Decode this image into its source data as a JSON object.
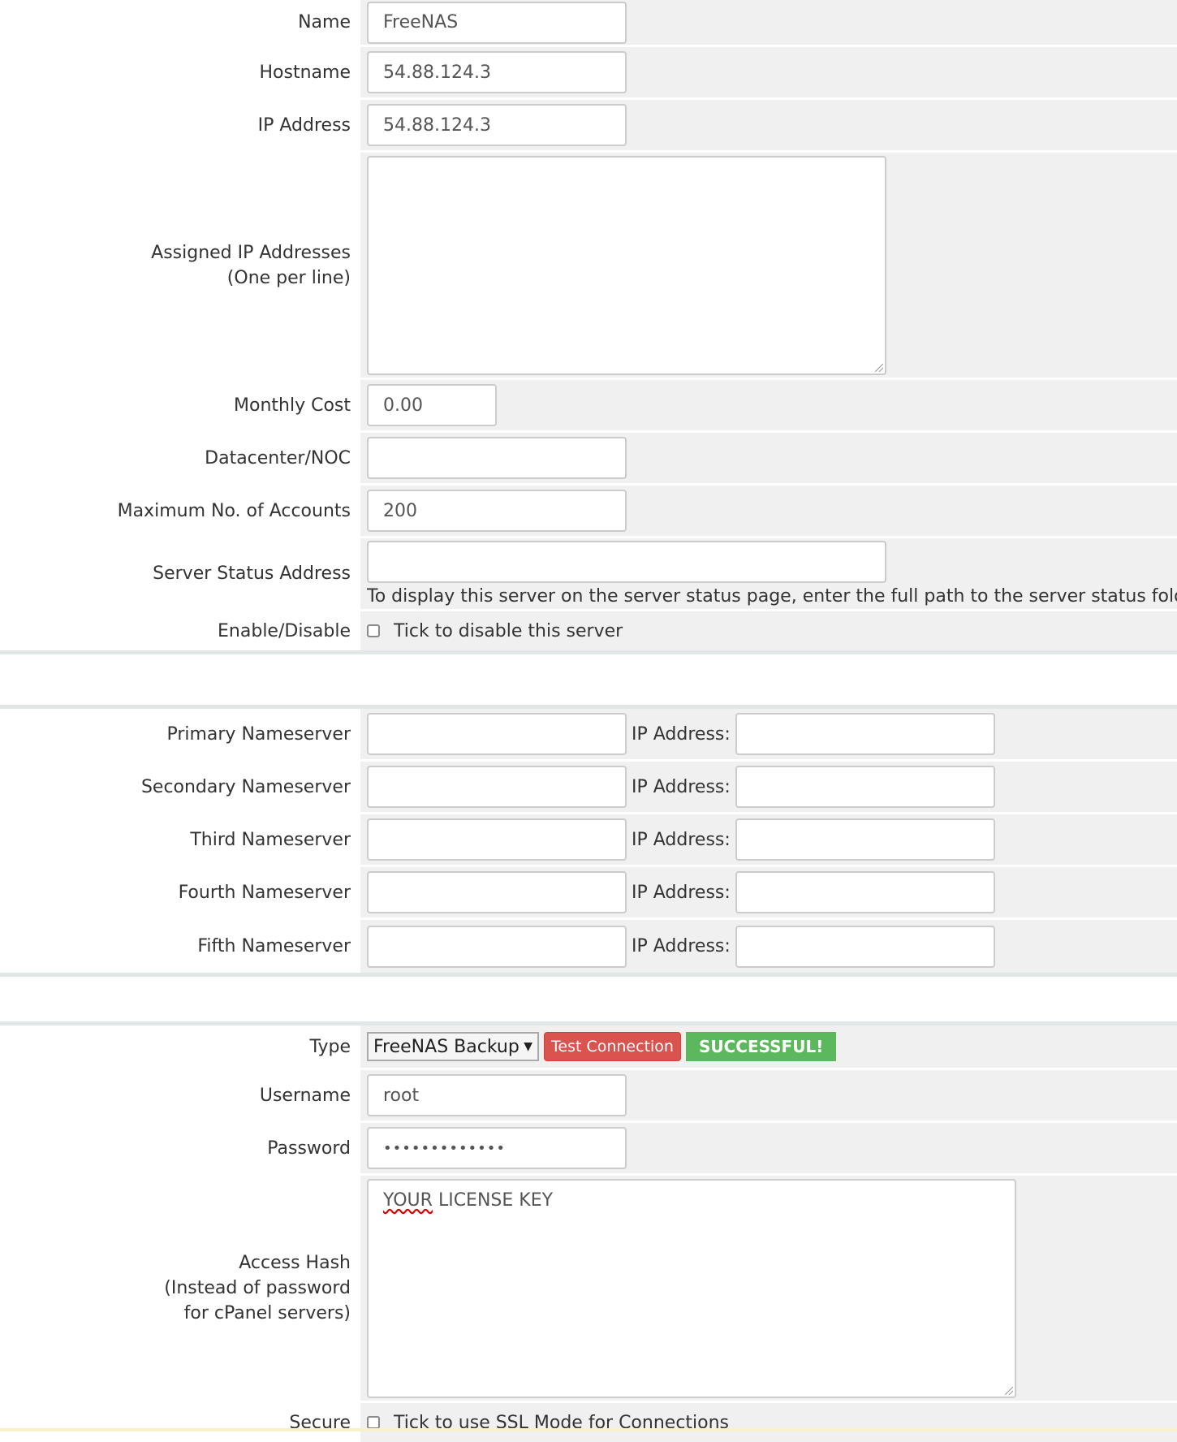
{
  "server": {
    "name_label": "Name",
    "name_value": "FreeNAS",
    "hostname_label": "Hostname",
    "hostname_value": "54.88.124.3",
    "ip_label": "IP Address",
    "ip_value": "54.88.124.3",
    "assigned_label_1": "Assigned IP Addresses",
    "assigned_label_2": "(One per line)",
    "assigned_value": "",
    "cost_label": "Monthly Cost",
    "cost_value": "0.00",
    "datacenter_label": "Datacenter/NOC",
    "datacenter_value": "",
    "max_label": "Maximum No. of Accounts",
    "max_value": "200",
    "status_label": "Server Status Address",
    "status_value": "",
    "status_help": "To display this server on the server status page, enter the full path to the server status folder (re",
    "disable_label": "Enable/Disable",
    "disable_text": "Tick to disable this server"
  },
  "nameservers": {
    "ip_label": "IP Address:",
    "items": [
      {
        "label": "Primary Nameserver",
        "value": "",
        "ip": ""
      },
      {
        "label": "Secondary Nameserver",
        "value": "",
        "ip": ""
      },
      {
        "label": "Third Nameserver",
        "value": "",
        "ip": ""
      },
      {
        "label": "Fourth Nameserver",
        "value": "",
        "ip": ""
      },
      {
        "label": "Fifth Nameserver",
        "value": "",
        "ip": ""
      }
    ]
  },
  "module": {
    "type_label": "Type",
    "type_value": "FreeNAS Backup",
    "test_button": "Test Connection",
    "status_badge": "SUCCESSFUL!",
    "username_label": "Username",
    "username_value": "root",
    "password_label": "Password",
    "password_value": "•••••••••••••",
    "hash_label_1": "Access Hash",
    "hash_label_2": "(Instead of password",
    "hash_label_3": "for cPanel servers)",
    "hash_value_1": "YOUR",
    "hash_value_2": " LICENSE KEY",
    "secure_label": "Secure",
    "secure_text": "Tick to use SSL Mode for Connections"
  }
}
